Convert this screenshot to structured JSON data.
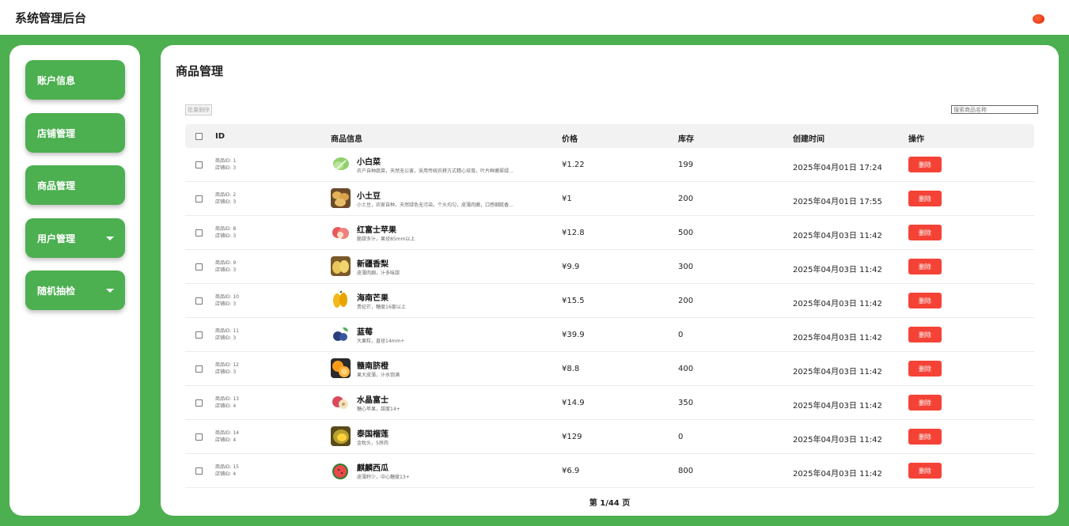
{
  "app": {
    "title": "系统管理后台"
  },
  "sidebar": {
    "items": [
      {
        "label": "账户信息",
        "has_caret": false
      },
      {
        "label": "店铺管理",
        "has_caret": false
      },
      {
        "label": "商品管理",
        "has_caret": false
      },
      {
        "label": "用户管理",
        "has_caret": true
      },
      {
        "label": "随机抽检",
        "has_caret": true
      }
    ]
  },
  "main": {
    "title": "商品管理",
    "batch_delete_label": "批量删除",
    "search_placeholder": "搜索商品名称",
    "columns": {
      "id": "ID",
      "info": "商品信息",
      "price": "价格",
      "stock": "库存",
      "created": "创建时间",
      "actions": "操作"
    },
    "rows": [
      {
        "product_id": "商品ID: 1",
        "shop_id": "店铺ID: 3",
        "name": "小白菜",
        "desc": "农户自种蔬菜，天然无公害，采用传统农耕方式精心培育。叶片鲜嫩翠绿…",
        "price": "¥1.22",
        "stock": "199",
        "created": "2025年04月01日 17:24",
        "thumb": "cabbage-thumbnail"
      },
      {
        "product_id": "商品ID: 2",
        "shop_id": "店铺ID: 3",
        "name": "小土豆",
        "desc": "小土豆，农家自种，天然绿色无污染。个头均匀，皮薄肉嫩，口感细腻香…",
        "price": "¥1",
        "stock": "200",
        "created": "2025年04月01日 17:55",
        "thumb": "potato-thumbnail"
      },
      {
        "product_id": "商品ID: 8",
        "shop_id": "店铺ID: 3",
        "name": "红富士苹果",
        "desc": "脆甜多汁，果径85mm以上",
        "price": "¥12.8",
        "stock": "500",
        "created": "2025年04月03日 11:42",
        "thumb": "apple-thumbnail"
      },
      {
        "product_id": "商品ID: 9",
        "shop_id": "店铺ID: 3",
        "name": "新疆香梨",
        "desc": "皮薄肉细，汁多味甜",
        "price": "¥9.9",
        "stock": "300",
        "created": "2025年04月03日 11:42",
        "thumb": "pear-thumbnail"
      },
      {
        "product_id": "商品ID: 10",
        "shop_id": "店铺ID: 3",
        "name": "海南芒果",
        "desc": "贵妃芒，糖度16度以上",
        "price": "¥15.5",
        "stock": "200",
        "created": "2025年04月03日 11:42",
        "thumb": "mango-thumbnail"
      },
      {
        "product_id": "商品ID: 11",
        "shop_id": "店铺ID: 3",
        "name": "蓝莓",
        "desc": "大果粒，直径14mm+",
        "price": "¥39.9",
        "stock": "0",
        "created": "2025年04月03日 11:42",
        "thumb": "blueberry-thumbnail"
      },
      {
        "product_id": "商品ID: 12",
        "shop_id": "店铺ID: 3",
        "name": "赣南脐橙",
        "desc": "果大皮薄，汁水饱满",
        "price": "¥8.8",
        "stock": "400",
        "created": "2025年04月03日 11:42",
        "thumb": "orange-thumbnail"
      },
      {
        "product_id": "商品ID: 13",
        "shop_id": "店铺ID: 4",
        "name": "水晶富士",
        "desc": "糖心苹果，甜度14+",
        "price": "¥14.9",
        "stock": "350",
        "created": "2025年04月03日 11:42",
        "thumb": "crystal-apple-thumbnail"
      },
      {
        "product_id": "商品ID: 14",
        "shop_id": "店铺ID: 4",
        "name": "泰国榴莲",
        "desc": "金枕头，5房肉",
        "price": "¥129",
        "stock": "0",
        "created": "2025年04月03日 11:42",
        "thumb": "durian-thumbnail"
      },
      {
        "product_id": "商品ID: 15",
        "shop_id": "店铺ID: 4",
        "name": "麒麟西瓜",
        "desc": "皮薄籽少，中心糖度13+",
        "price": "¥6.9",
        "stock": "800",
        "created": "2025年04月03日 11:42",
        "thumb": "watermelon-thumbnail"
      }
    ],
    "delete_label": "删除",
    "pagination": "第 1/44 页"
  },
  "colors": {
    "brand_green": "#4caf50",
    "danger_red": "#f44336"
  }
}
